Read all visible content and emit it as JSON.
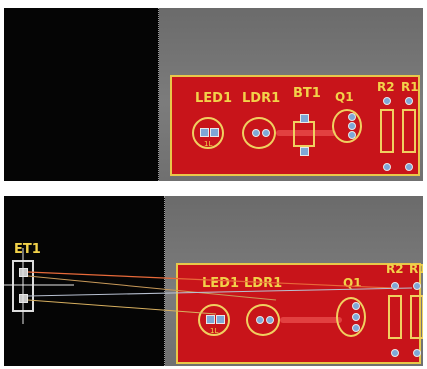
{
  "top_view": {
    "labels": {
      "led": "LED1",
      "ldr": "LDR1",
      "bt": "BT1",
      "q": "Q1",
      "r2": "R2",
      "r1": "R1"
    },
    "led_tag": "1L"
  },
  "bottom_view": {
    "labels": {
      "et": "ET1",
      "led": "LED1",
      "ldr": "LDR1",
      "q": "Q1",
      "r2": "R2",
      "r1": "R1"
    },
    "led_tag": "1L"
  },
  "colors": {
    "board": "#c8141a",
    "silkscreen": "#f2d24a",
    "pad": "#7fa7d6",
    "background_grey": "#777777",
    "background_black": "#050505"
  }
}
